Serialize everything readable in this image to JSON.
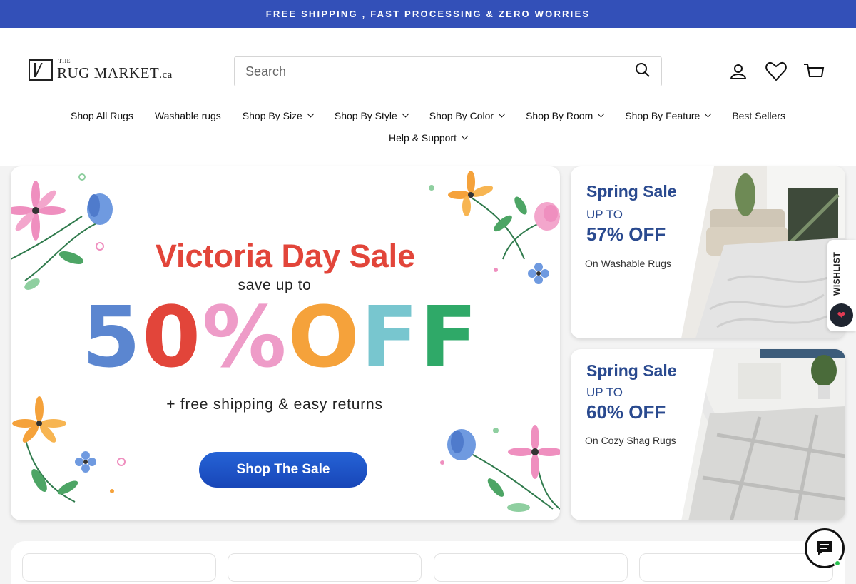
{
  "announcement": "FREE SHIPPING , FAST PROCESSING & ZERO WORRIES",
  "logo": {
    "the": "THE",
    "name": "RUG MARKET",
    "tld": ".ca"
  },
  "search": {
    "placeholder": "Search"
  },
  "icons": {
    "search": "search-icon",
    "account": "user-icon",
    "wishlist": "heart-icon",
    "cart": "cart-icon",
    "chat": "chat-icon"
  },
  "nav": {
    "row1": [
      {
        "label": "Shop All Rugs",
        "dropdown": false
      },
      {
        "label": "Washable rugs",
        "dropdown": false
      },
      {
        "label": "Shop By Size",
        "dropdown": true
      },
      {
        "label": "Shop By Style",
        "dropdown": true
      },
      {
        "label": "Shop By Color",
        "dropdown": true
      },
      {
        "label": "Shop By Room",
        "dropdown": true
      },
      {
        "label": "Shop By Feature",
        "dropdown": true
      },
      {
        "label": "Best Sellers",
        "dropdown": false
      }
    ],
    "row2": [
      {
        "label": "Help & Support",
        "dropdown": true
      }
    ]
  },
  "hero": {
    "title": "Victoria Day Sale",
    "subtitle": "save up to",
    "big_percent": [
      "5",
      "0",
      "%",
      "O",
      "F",
      "F"
    ],
    "big_colors": [
      "#5b86d0",
      "#e2453a",
      "#ee9cc8",
      "#f5a23b",
      "#78c6cf",
      "#2fa968"
    ],
    "free_text": "+ free shipping & easy returns",
    "button": "Shop The Sale"
  },
  "promos": [
    {
      "title": "Spring Sale",
      "up_to": "UP TO",
      "off": "57% OFF",
      "on": "On Washable Rugs"
    },
    {
      "title": "Spring Sale",
      "up_to": "UP TO",
      "off": "60% OFF",
      "on": "On Cozy Shag Rugs"
    }
  ],
  "wishlist_tab": "WISHLIST",
  "colors": {
    "announcement_bg": "#3350b8",
    "promo_text": "#2a4a8f",
    "hero_title": "#e2453a",
    "button_blue": "#1f55c8"
  }
}
